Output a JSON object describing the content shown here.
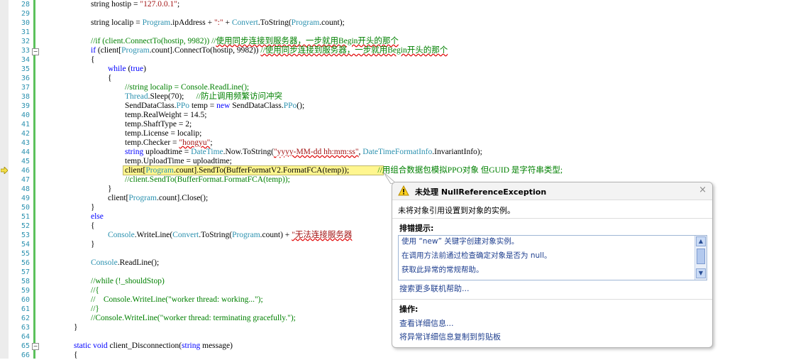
{
  "code_lines": [
    {
      "num": "28",
      "indent": 128,
      "tokens": [
        {
          "t": "string hostip = "
        },
        {
          "t": "\"127.0.0.1\"",
          "c": "st"
        },
        {
          "t": ";"
        }
      ]
    },
    {
      "num": "29",
      "indent": 0,
      "tokens": []
    },
    {
      "num": "30",
      "indent": 128,
      "tokens": [
        {
          "t": "string localip = "
        },
        {
          "t": "Program",
          "c": "ty"
        },
        {
          "t": ".ipAddress + "
        },
        {
          "t": "\":\"",
          "c": "st"
        },
        {
          "t": " + "
        },
        {
          "t": "Convert",
          "c": "ty"
        },
        {
          "t": ".ToString("
        },
        {
          "t": "Program",
          "c": "ty"
        },
        {
          "t": ".count);"
        }
      ]
    },
    {
      "num": "31",
      "indent": 0,
      "tokens": []
    },
    {
      "num": "32",
      "indent": 128,
      "tokens": [
        {
          "t": "//if (client.ConnectTo(hostip, 9982)) //",
          "c": "cm"
        },
        {
          "t": "使用同步连接到服务器，一步就用Begin开头的那个",
          "c": "cm",
          "sq": true
        }
      ]
    },
    {
      "num": "33",
      "indent": 128,
      "tokens": [
        {
          "t": "if",
          "c": "kw"
        },
        {
          "t": " (client["
        },
        {
          "t": "Program",
          "c": "ty"
        },
        {
          "t": ".count].ConnectTo(hostip, 9982)) "
        },
        {
          "t": "//使用同步连接到服务器，一步就用Begin开头的那个",
          "c": "cm",
          "sq": true
        }
      ]
    },
    {
      "num": "34",
      "indent": 128,
      "tokens": [
        {
          "t": "{"
        }
      ]
    },
    {
      "num": "35",
      "indent": 152,
      "tokens": [
        {
          "t": "while",
          "c": "kw"
        },
        {
          "t": " ("
        },
        {
          "t": "true",
          "c": "kw"
        },
        {
          "t": ")"
        }
      ]
    },
    {
      "num": "36",
      "indent": 152,
      "tokens": [
        {
          "t": "{"
        }
      ]
    },
    {
      "num": "37",
      "indent": 176,
      "tokens": [
        {
          "t": "//string localip = Console.ReadLine();",
          "c": "cm"
        }
      ]
    },
    {
      "num": "38",
      "indent": 176,
      "tokens": [
        {
          "t": "Thread",
          "c": "ty"
        },
        {
          "t": ".Sleep(70);      "
        },
        {
          "t": "//防止调用频繁访问冲突",
          "c": "cm"
        }
      ]
    },
    {
      "num": "39",
      "indent": 176,
      "tokens": [
        {
          "t": "SendDataClass.",
          "c": ""
        },
        {
          "t": "PPo",
          "c": "ty"
        },
        {
          "t": " temp = "
        },
        {
          "t": "new",
          "c": "kw"
        },
        {
          "t": " SendDataClass."
        },
        {
          "t": "PPo",
          "c": "ty"
        },
        {
          "t": "();"
        }
      ]
    },
    {
      "num": "40",
      "indent": 176,
      "tokens": [
        {
          "t": "temp.RealWeight = 14.5;"
        }
      ]
    },
    {
      "num": "41",
      "indent": 176,
      "tokens": [
        {
          "t": "temp.ShaftType = 2;"
        }
      ]
    },
    {
      "num": "42",
      "indent": 176,
      "tokens": [
        {
          "t": "temp.License = localip;"
        }
      ]
    },
    {
      "num": "43",
      "indent": 176,
      "tokens": [
        {
          "t": "temp.Checker = "
        },
        {
          "t": "\"hongyu\"",
          "c": "st",
          "sq": true
        },
        {
          "t": ";"
        }
      ]
    },
    {
      "num": "44",
      "indent": 176,
      "tokens": [
        {
          "t": "string",
          "c": "kw"
        },
        {
          "t": " uploadtime = "
        },
        {
          "t": "DateTime",
          "c": "ty"
        },
        {
          "t": ".Now.ToString("
        },
        {
          "t": "\"yyyy-MM-dd hh:mm:ss\"",
          "c": "st",
          "sq": true
        },
        {
          "t": ", "
        },
        {
          "t": "DateTimeFormatInfo",
          "c": "ty"
        },
        {
          "t": ".InvariantInfo);"
        }
      ]
    },
    {
      "num": "45",
      "indent": 176,
      "tokens": [
        {
          "t": "temp.UploadTime = uploadtime;"
        }
      ]
    },
    {
      "num": "46",
      "indent": 176,
      "tokens": [
        {
          "t": "client["
        },
        {
          "t": "Program",
          "c": "ty"
        },
        {
          "t": ".count].SendTo(BufferFormatV2.FormatFCA(temp));"
        },
        {
          "t": "              //用组合数据包模拟PPO对象 但GUID 是字符串类型;",
          "c": "cm"
        }
      ]
    },
    {
      "num": "47",
      "indent": 176,
      "tokens": [
        {
          "t": "//client.SendTo(BufferFormat.FormatFCA(temp));",
          "c": "cm"
        }
      ]
    },
    {
      "num": "48",
      "indent": 152,
      "tokens": [
        {
          "t": "}"
        }
      ]
    },
    {
      "num": "49",
      "indent": 152,
      "tokens": [
        {
          "t": "client["
        },
        {
          "t": "Program",
          "c": "ty"
        },
        {
          "t": ".count].Close();"
        }
      ]
    },
    {
      "num": "50",
      "indent": 128,
      "tokens": [
        {
          "t": "}"
        }
      ]
    },
    {
      "num": "51",
      "indent": 128,
      "tokens": [
        {
          "t": "else",
          "c": "kw"
        }
      ]
    },
    {
      "num": "52",
      "indent": 128,
      "tokens": [
        {
          "t": "{"
        }
      ]
    },
    {
      "num": "53",
      "indent": 152,
      "tokens": [
        {
          "t": "Console",
          "c": "ty"
        },
        {
          "t": ".WriteLine("
        },
        {
          "t": "Convert",
          "c": "ty"
        },
        {
          "t": ".ToString("
        },
        {
          "t": "Program",
          "c": "ty"
        },
        {
          "t": ".count) + "
        },
        {
          "t": "\"无法连接服务器",
          "c": "st",
          "sq": true
        }
      ]
    },
    {
      "num": "54",
      "indent": 128,
      "tokens": [
        {
          "t": "}"
        }
      ]
    },
    {
      "num": "55",
      "indent": 0,
      "tokens": []
    },
    {
      "num": "56",
      "indent": 128,
      "tokens": [
        {
          "t": "Console",
          "c": "ty"
        },
        {
          "t": ".ReadLine();"
        }
      ]
    },
    {
      "num": "57",
      "indent": 0,
      "tokens": []
    },
    {
      "num": "58",
      "indent": 128,
      "tokens": [
        {
          "t": "//while (!_shouldStop)",
          "c": "cm"
        }
      ]
    },
    {
      "num": "59",
      "indent": 128,
      "tokens": [
        {
          "t": "//{",
          "c": "cm"
        }
      ]
    },
    {
      "num": "60",
      "indent": 128,
      "tokens": [
        {
          "t": "//    Console.WriteLine(\"worker thread: working...\");",
          "c": "cm"
        }
      ]
    },
    {
      "num": "61",
      "indent": 128,
      "tokens": [
        {
          "t": "//}",
          "c": "cm"
        }
      ]
    },
    {
      "num": "62",
      "indent": 128,
      "tokens": [
        {
          "t": "//Console.WriteLine(\"worker thread: terminating gracefully.\");",
          "c": "cm"
        }
      ]
    },
    {
      "num": "63",
      "indent": 104,
      "tokens": [
        {
          "t": "}"
        }
      ]
    },
    {
      "num": "64",
      "indent": 0,
      "tokens": []
    },
    {
      "num": "65",
      "indent": 104,
      "tokens": [
        {
          "t": "static",
          "c": "kw"
        },
        {
          "t": " "
        },
        {
          "t": "void",
          "c": "kw"
        },
        {
          "t": " client_Disconnection("
        },
        {
          "t": "string",
          "c": "kw"
        },
        {
          "t": " message)"
        }
      ]
    },
    {
      "num": "66",
      "indent": 104,
      "tokens": [
        {
          "t": "{"
        }
      ]
    }
  ],
  "exception_popup": {
    "title": "未处理 NullReferenceException",
    "message": "未将对象引用设置到对象的实例。",
    "tips_heading": "排错提示:",
    "tips": [
      "使用 “new” 关键字创建对象实例。",
      "在调用方法前通过检查确定对象是否为 null。",
      "获取此异常的常规帮助。"
    ],
    "search_link": "搜索更多联机帮助...",
    "actions_heading": "操作:",
    "actions": [
      "查看详细信息...",
      "将异常详细信息复制到剪贴板"
    ],
    "close_glyph": "×"
  },
  "icons": {
    "execution_arrow": "current-statement-arrow-icon",
    "warning": "warning-icon"
  },
  "colors": {
    "keyword": "#0000ff",
    "type": "#2b91af",
    "string": "#a31515",
    "comment": "#008000",
    "highlight": "#fff68f",
    "change_bar": "#5cc15c"
  }
}
